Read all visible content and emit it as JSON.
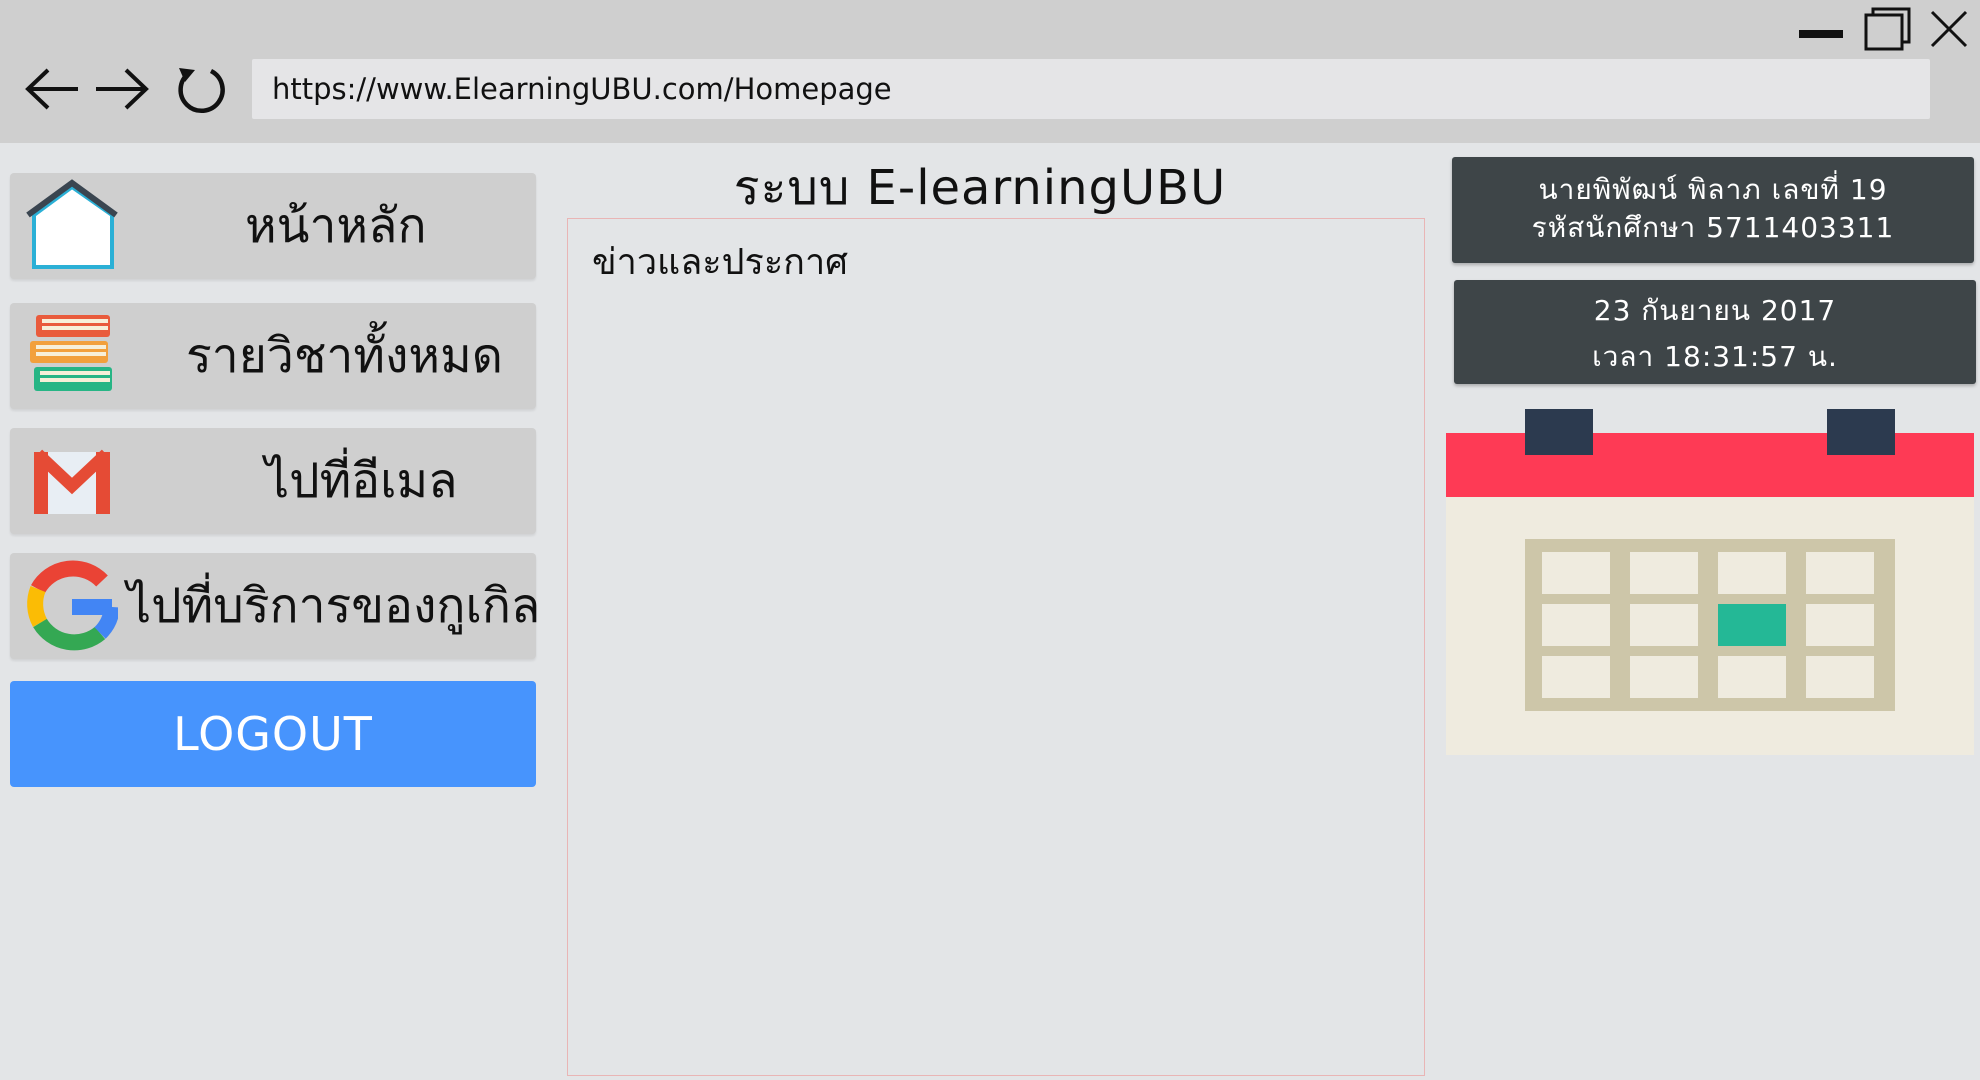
{
  "browser": {
    "url": "https://www.ElearningUBU.com/Homepage",
    "window_controls": [
      "minimize-icon",
      "maximize-icon",
      "close-icon"
    ],
    "nav_icons": [
      "back-arrow-icon",
      "forward-arrow-icon",
      "reload-icon"
    ]
  },
  "sidebar": {
    "items": [
      {
        "label": "หน้าหลัก",
        "icon": "home-icon"
      },
      {
        "label": "รายวิชาทั้งหมด",
        "icon": "books-icon"
      },
      {
        "label": "ไปที่อีเมล",
        "icon": "gmail-icon"
      },
      {
        "label": "ไปที่บริการของกูเกิล",
        "icon": "google-icon"
      }
    ],
    "logout_label": "LOGOUT"
  },
  "main": {
    "title": "ระบบ E-learningUBU",
    "news_heading": "ข่าวและประกาศ"
  },
  "profile": {
    "name_line": "นายพิพัฒน์ พิลาภ เลขที่ 19",
    "student_id_line": "รหัสนักศึกษา 5711403311"
  },
  "datetime": {
    "date": "23 กันยายน 2017",
    "time": "เวลา 18:31:57 น."
  },
  "colors": {
    "chrome": "#cfcfcf",
    "background": "#e3e5e7",
    "menu_button": "#cfcfcf",
    "logout": "#4794fd",
    "card": "#3e4548",
    "calendar_header": "#fe3a55",
    "calendar_body": "#efebdf",
    "calendar_grid": "#cdc6a9",
    "calendar_highlight": "#24b896"
  }
}
